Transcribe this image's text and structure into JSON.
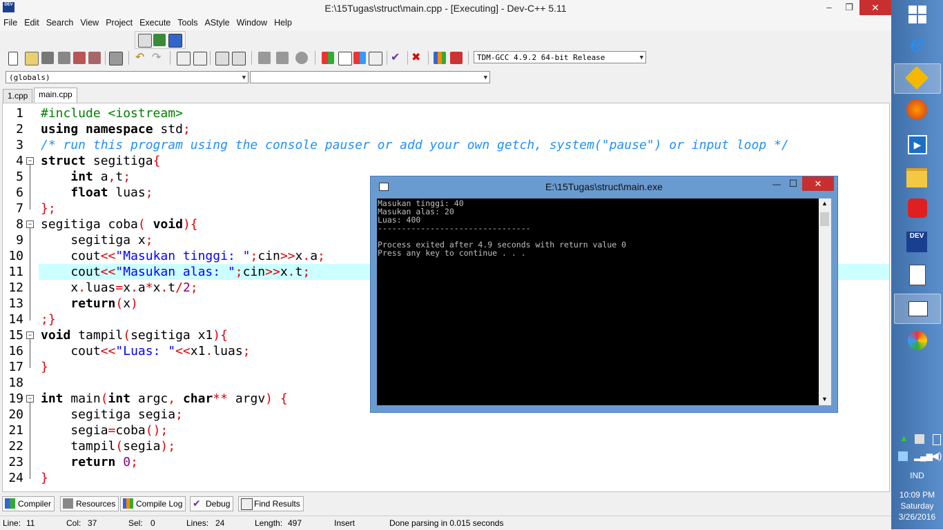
{
  "window": {
    "title": "E:\\15Tugas\\struct\\main.cpp - [Executing] - Dev-C++ 5.11",
    "icon_label": "DEV",
    "minimize": "‒",
    "maximize": "❐",
    "close": "✕"
  },
  "menu": [
    "File",
    "Edit",
    "Search",
    "View",
    "Project",
    "Execute",
    "Tools",
    "AStyle",
    "Window",
    "Help"
  ],
  "toolbar": {
    "compiler_select": "TDM-GCC 4.9.2 64-bit Release",
    "scope_select": "(globals)",
    "member_select": ""
  },
  "tabs": [
    {
      "label": "1.cpp",
      "active": false
    },
    {
      "label": "main.cpp",
      "active": true
    }
  ],
  "editor": {
    "highlighted_line": 11,
    "line_numbers": [
      "1",
      "2",
      "3",
      "4",
      "5",
      "6",
      "7",
      "8",
      "9",
      "10",
      "11",
      "12",
      "13",
      "14",
      "15",
      "16",
      "17",
      "18",
      "19",
      "20",
      "21",
      "22",
      "23",
      "24"
    ]
  },
  "console": {
    "title": "E:\\15Tugas\\struct\\main.exe",
    "lines": [
      "Masukan tinggi: 40",
      "Masukan alas: 20",
      "Luas: 400",
      "--------------------------------",
      "Process exited after 4.9 seconds with return value 0",
      "Press any key to continue . . ."
    ],
    "minimize": "—",
    "maximize": "☐",
    "close": "✕"
  },
  "bottom_tabs": [
    {
      "label": "Compiler",
      "icon": "compiler-grid-icon"
    },
    {
      "label": "Resources",
      "icon": "resources-icon"
    },
    {
      "label": "Compile Log",
      "icon": "compile-log-chart-icon"
    },
    {
      "label": "Debug",
      "icon": "debug-check-icon"
    },
    {
      "label": "Find Results",
      "icon": "find-results-icon"
    }
  ],
  "status": {
    "line_label": "Line:",
    "line_value": "11",
    "col_label": "Col:",
    "col_value": "37",
    "sel_label": "Sel:",
    "sel_value": "0",
    "lines_label": "Lines:",
    "lines_value": "24",
    "length_label": "Length:",
    "length_value": "497",
    "mode": "Insert",
    "message": "Done parsing in 0.015 seconds"
  },
  "taskbar": {
    "language": "IND",
    "time": "10:09 PM",
    "day": "Saturday",
    "date": "3/26/2016",
    "dev_icon_label": "DEV"
  },
  "colors": {
    "keyword": "#000000",
    "preprocessor": "#008000",
    "comment": "#1e90ff",
    "operator": "#e00000",
    "string": "#0000ff",
    "number": "#800080",
    "current_line": "#ccffff",
    "taskbar": "#4f81bd"
  }
}
